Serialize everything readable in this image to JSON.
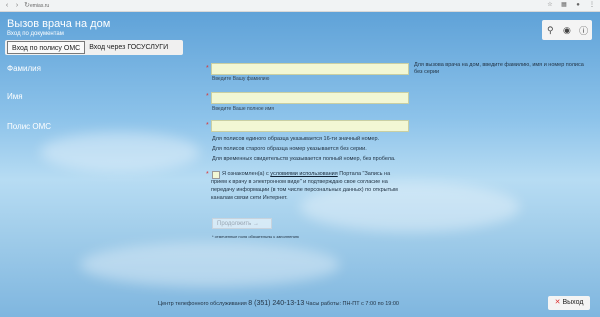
{
  "browser": {
    "url": "emias.ru"
  },
  "header": {
    "title": "Вызов врача на дом",
    "subtitle": "Вход по документам"
  },
  "toolbar": {
    "icons": [
      "key-icon",
      "eye-icon",
      "info-icon"
    ]
  },
  "tabs": [
    {
      "label": "Вход по полису ОМС"
    },
    {
      "label": "Вход через ГОСУСЛУГИ"
    }
  ],
  "form": {
    "surname": {
      "label": "Фамилия",
      "hint": "Введите Вашу фамилию",
      "value": ""
    },
    "name": {
      "label": "Имя",
      "hint": "Введите Ваше полное имя",
      "value": ""
    },
    "oms": {
      "label": "Полис ОМС",
      "value": "",
      "hints": [
        "Для полисов единого образца указывается 16-ти значный номер.",
        "Для полисов старого образца номер указывается без серии.",
        "Для временных свидетельств указывается полный номер, без пробела."
      ]
    },
    "tip": "Для вызова врача на дом, введите фамилию, имя и номер полиса без серии",
    "consent": {
      "prefix": "Я ознакомлен(а) с",
      "link": "условиями использования",
      "suffix": "Портала \"Запись на прием к врачу в электронном виде\" и подтверждаю свое согласие на передачу информации (в том числе персональных данных) по открытым каналам связи сети Интернет."
    },
    "submit": "Продолжить →",
    "required_note": "* отмеченные поля обязательны к заполнению"
  },
  "footer": {
    "call_center": "Центр телефонного обслуживания",
    "phone": "8 (351) 240-13-13",
    "hours": "Часы работы: ПН-ПТ с 7:00 по 19:00"
  },
  "exit": {
    "label": "Выход"
  }
}
